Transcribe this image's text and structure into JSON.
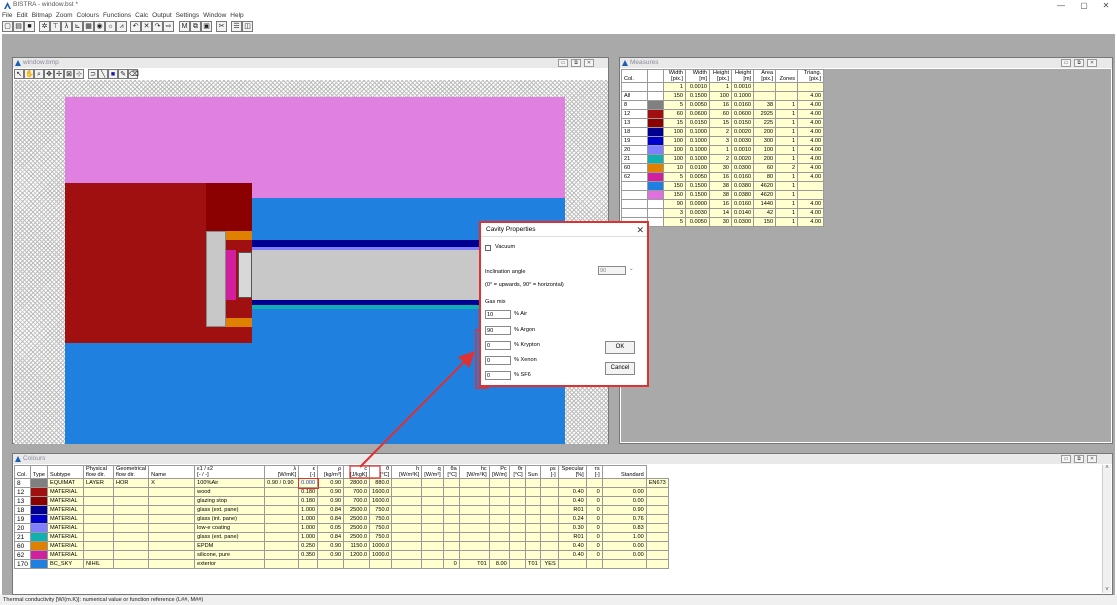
{
  "app": {
    "title": "BISTRA - window.bst *",
    "menu": [
      "File",
      "Edit",
      "Bitmap",
      "Zoom",
      "Colours",
      "Functions",
      "Calc",
      "Output",
      "Settings",
      "Window",
      "Help"
    ],
    "window_controls": {
      "minimize": "—",
      "maximize": "▢",
      "close": "✕"
    }
  },
  "drawing_window": {
    "title": "window.bmp"
  },
  "measures_window": {
    "title": "Measures",
    "headers": [
      {
        "l1": "Col.",
        "l2": ""
      },
      {
        "l1": "",
        "l2": ""
      },
      {
        "l1": "Width",
        "l2": "[pix.]"
      },
      {
        "l1": "Width",
        "l2": "[m]"
      },
      {
        "l1": "Height",
        "l2": "[pix.]"
      },
      {
        "l1": "Height",
        "l2": "[m]"
      },
      {
        "l1": "Area",
        "l2": "[pix.]"
      },
      {
        "l1": "Zones",
        "l2": ""
      },
      {
        "l1": "Triang.",
        "l2": "[pix.]"
      }
    ],
    "rows": [
      {
        "col": "",
        "color": "",
        "w_pix": "1",
        "w_m": "0.0010",
        "h_pix": "1",
        "h_m": "0.0010",
        "area": "",
        "zones": "",
        "tri": ""
      },
      {
        "col": "All",
        "color": "",
        "w_pix": "150",
        "w_m": "0.1500",
        "h_pix": "100",
        "h_m": "0.1000",
        "area": "",
        "zones": "",
        "tri": "4.00"
      },
      {
        "col": "8",
        "color": "#808080",
        "w_pix": "5",
        "w_m": "0.0050",
        "h_pix": "16",
        "h_m": "0.0160",
        "area": "38",
        "zones": "1",
        "tri": "4.00"
      },
      {
        "col": "12",
        "color": "#a01010",
        "w_pix": "60",
        "w_m": "0.0600",
        "h_pix": "60",
        "h_m": "0.0600",
        "area": "2925",
        "zones": "1",
        "tri": "4.00"
      },
      {
        "col": "13",
        "color": "#8b0000",
        "w_pix": "15",
        "w_m": "0.0150",
        "h_pix": "15",
        "h_m": "0.0150",
        "area": "225",
        "zones": "1",
        "tri": "4.00"
      },
      {
        "col": "18",
        "color": "#000090",
        "w_pix": "100",
        "w_m": "0.1000",
        "h_pix": "2",
        "h_m": "0.0020",
        "area": "200",
        "zones": "1",
        "tri": "4.00"
      },
      {
        "col": "19",
        "color": "#0000cc",
        "w_pix": "100",
        "w_m": "0.1000",
        "h_pix": "3",
        "h_m": "0.0030",
        "area": "300",
        "zones": "1",
        "tri": "4.00"
      },
      {
        "col": "20",
        "color": "#8080ff",
        "w_pix": "100",
        "w_m": "0.1000",
        "h_pix": "1",
        "h_m": "0.0010",
        "area": "100",
        "zones": "1",
        "tri": "4.00"
      },
      {
        "col": "21",
        "color": "#10b0b0",
        "w_pix": "100",
        "w_m": "0.1000",
        "h_pix": "2",
        "h_m": "0.0020",
        "area": "200",
        "zones": "1",
        "tri": "4.00"
      },
      {
        "col": "60",
        "color": "#e08000",
        "w_pix": "10",
        "w_m": "0.0100",
        "h_pix": "30",
        "h_m": "0.0300",
        "area": "60",
        "zones": "2",
        "tri": "4.00"
      },
      {
        "col": "62",
        "color": "#d020a0",
        "w_pix": "5",
        "w_m": "0.0050",
        "h_pix": "16",
        "h_m": "0.0160",
        "area": "80",
        "zones": "1",
        "tri": "4.00"
      },
      {
        "col": "",
        "color": "#2080e0",
        "w_pix": "150",
        "w_m": "0.1500",
        "h_pix": "38",
        "h_m": "0.0380",
        "area": "4620",
        "zones": "1",
        "tri": ""
      },
      {
        "col": "",
        "color": "#e070e0",
        "w_pix": "150",
        "w_m": "0.1500",
        "h_pix": "38",
        "h_m": "0.0380",
        "area": "4620",
        "zones": "1",
        "tri": ""
      },
      {
        "col": "",
        "color": "",
        "w_pix": "90",
        "w_m": "0.0900",
        "h_pix": "16",
        "h_m": "0.0160",
        "area": "1440",
        "zones": "1",
        "tri": "4.00"
      },
      {
        "col": "",
        "color": "",
        "w_pix": "3",
        "w_m": "0.0030",
        "h_pix": "14",
        "h_m": "0.0140",
        "area": "42",
        "zones": "1",
        "tri": "4.00"
      },
      {
        "col": "",
        "color": "",
        "w_pix": "5",
        "w_m": "0.0050",
        "h_pix": "30",
        "h_m": "0.0300",
        "area": "150",
        "zones": "1",
        "tri": "4.00"
      }
    ]
  },
  "colours_window": {
    "title": "Colours",
    "headers": [
      {
        "l1": "Col.",
        "l2": ""
      },
      {
        "l1": "Type",
        "l2": ""
      },
      {
        "l1": "Subtype",
        "l2": ""
      },
      {
        "l1": "Physical",
        "l2": "flow dir."
      },
      {
        "l1": "Geometrical",
        "l2": "flow dir."
      },
      {
        "l1": "Name",
        "l2": ""
      },
      {
        "l1": "ε1 / ε2",
        "l2": "[- / -]"
      },
      {
        "l1": "λ",
        "l2": "[W/mK]"
      },
      {
        "l1": "ε",
        "l2": "[-]"
      },
      {
        "l1": "ρ",
        "l2": "[kg/m³]"
      },
      {
        "l1": "c",
        "l2": "[J/kgK]"
      },
      {
        "l1": "θ",
        "l2": "[°C]"
      },
      {
        "l1": "h",
        "l2": "[W/m²K]"
      },
      {
        "l1": "q",
        "l2": "[W/m²]"
      },
      {
        "l1": "θa",
        "l2": "[°C]"
      },
      {
        "l1": "hc",
        "l2": "[W/m²K]"
      },
      {
        "l1": "Pc",
        "l2": "[W/m]"
      },
      {
        "l1": "θr",
        "l2": "[°C]"
      },
      {
        "l1": "Sun",
        "l2": ""
      },
      {
        "l1": "ρs",
        "l2": "[-]"
      },
      {
        "l1": "Specular",
        "l2": "[%]"
      },
      {
        "l1": "τs",
        "l2": "[-]"
      },
      {
        "l1": "Standard",
        "l2": ""
      }
    ],
    "rows": [
      {
        "col": "8",
        "color": "#808080",
        "cells": [
          "EQUIMAT",
          "LAYER",
          "HOR",
          "X",
          "100%Air",
          "0.90 / 0.90",
          "0.000",
          "0.90",
          "2800.0",
          "880.0",
          "",
          "",
          "",
          "",
          "",
          "",
          "",
          "",
          "",
          "",
          "",
          "EN673"
        ]
      },
      {
        "col": "12",
        "color": "#a01010",
        "cells": [
          "MATERIAL",
          "",
          "",
          "",
          "wood",
          "",
          "0.180",
          "0.90",
          "700.0",
          "1600.0",
          "",
          "",
          "",
          "",
          "",
          "",
          "",
          "",
          "0.40",
          "0",
          "0.00",
          ""
        ]
      },
      {
        "col": "13",
        "color": "#8b0000",
        "cells": [
          "MATERIAL",
          "",
          "",
          "",
          "glazing stop",
          "",
          "0.180",
          "0.90",
          "700.0",
          "1600.0",
          "",
          "",
          "",
          "",
          "",
          "",
          "",
          "",
          "0.40",
          "0",
          "0.00",
          ""
        ]
      },
      {
        "col": "18",
        "color": "#000090",
        "cells": [
          "MATERIAL",
          "",
          "",
          "",
          "glass (ext. pane)",
          "",
          "1.000",
          "0.84",
          "2500.0",
          "750.0",
          "",
          "",
          "",
          "",
          "",
          "",
          "",
          "",
          "R01",
          "0",
          "0.90",
          ""
        ]
      },
      {
        "col": "19",
        "color": "#0000cc",
        "cells": [
          "MATERIAL",
          "",
          "",
          "",
          "glass (int. pane)",
          "",
          "1.000",
          "0.84",
          "2500.0",
          "750.0",
          "",
          "",
          "",
          "",
          "",
          "",
          "",
          "",
          "0.24",
          "0",
          "0.76",
          ""
        ]
      },
      {
        "col": "20",
        "color": "#8080ff",
        "cells": [
          "MATERIAL",
          "",
          "",
          "",
          "low-e coating",
          "",
          "1.000",
          "0.05",
          "2500.0",
          "750.0",
          "",
          "",
          "",
          "",
          "",
          "",
          "",
          "",
          "0.30",
          "0",
          "0.83",
          ""
        ]
      },
      {
        "col": "21",
        "color": "#10b0b0",
        "cells": [
          "MATERIAL",
          "",
          "",
          "",
          "glass (ext. pane)",
          "",
          "1.000",
          "0.84",
          "2500.0",
          "750.0",
          "",
          "",
          "",
          "",
          "",
          "",
          "",
          "",
          "R01",
          "0",
          "1.00",
          ""
        ]
      },
      {
        "col": "60",
        "color": "#e08000",
        "cells": [
          "MATERIAL",
          "",
          "",
          "",
          "EPDM",
          "",
          "0.250",
          "0.90",
          "1150.0",
          "1000.0",
          "",
          "",
          "",
          "",
          "",
          "",
          "",
          "",
          "0.40",
          "0",
          "0.00",
          ""
        ]
      },
      {
        "col": "62",
        "color": "#d020a0",
        "cells": [
          "MATERIAL",
          "",
          "",
          "",
          "silicone, pure",
          "",
          "0.350",
          "0.90",
          "1200.0",
          "1000.0",
          "",
          "",
          "",
          "",
          "",
          "",
          "",
          "",
          "0.40",
          "0",
          "0.00",
          ""
        ]
      },
      {
        "col": "170",
        "color": "#2080e0",
        "cells": [
          "BC_SKY",
          "NIHIL",
          "",
          "",
          "exterior",
          "",
          "",
          "",
          "",
          "",
          "",
          "",
          "0",
          "T01",
          "8.00",
          "",
          "T01",
          "YES",
          "",
          "",
          "",
          ""
        ]
      }
    ]
  },
  "dialog": {
    "title": "Cavity Properties",
    "vacuum_label": "Vacuum",
    "inclination_label": "Inclination angle",
    "inclination_value": "90",
    "inclination_hint": "(0° = upwards, 90° = horizontal)",
    "gas_mix_label": "Gas mix",
    "gases": [
      {
        "value": "10",
        "label": "% Air"
      },
      {
        "value": "90",
        "label": "% Argon"
      },
      {
        "value": "0",
        "label": "% Krypton"
      },
      {
        "value": "0",
        "label": "% Xenon"
      },
      {
        "value": "0",
        "label": "% SF6"
      }
    ],
    "ok_label": "OK",
    "cancel_label": "Cancel"
  },
  "status": {
    "text": "Thermal conductivity [W/(m.K)]: numerical value or function reference (L##, M##)"
  },
  "colors": {
    "accent_red": "#e03030",
    "magenta": "#e080e0",
    "wood": "#a01010",
    "blue_ext": "#2080e0"
  }
}
